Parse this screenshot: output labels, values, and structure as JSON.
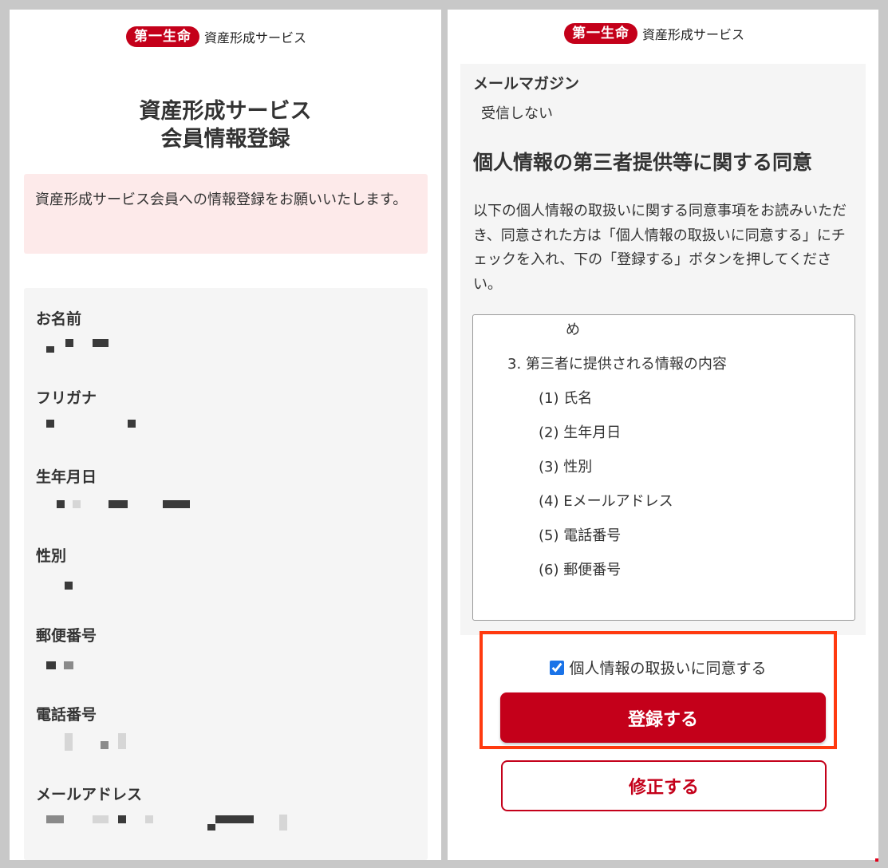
{
  "brand": {
    "logo_text": "第一生命",
    "service_name": "資産形成サービス"
  },
  "left": {
    "title_line1": "資産形成サービス",
    "title_line2": "会員情報登録",
    "notice": "資産形成サービス会員への情報登録をお願いいたします。",
    "fields": {
      "name_label": "お名前",
      "furigana_label": "フリガナ",
      "birthdate_label": "生年月日",
      "gender_label": "性別",
      "postal_label": "郵便番号",
      "phone_label": "電話番号",
      "email_label": "メールアドレス"
    }
  },
  "right": {
    "mail_magazine_label": "メールマガジン",
    "mail_magazine_value": "受信しない",
    "consent_heading": "個人情報の第三者提供等に関する同意",
    "consent_description": "以下の個人情報の取扱いに関する同意事項をお読みいただき、同意された方は「個人情報の取扱いに同意する」にチェックを入れ、下の「登録する」ボタンを押してください。",
    "consent_text": {
      "partial_top": "め",
      "section3": "3. 第三者に提供される情報の内容",
      "items": [
        "(1) 氏名",
        "(2) 生年月日",
        "(3) 性別",
        "(4) Eメールアドレス",
        "(5) 電話番号",
        "(6) 郵便番号"
      ]
    },
    "agree_label": "個人情報の取扱いに同意する",
    "agree_checked": true,
    "register_button": "登録する",
    "edit_button": "修正する"
  },
  "colors": {
    "brand_red": "#c4001a",
    "highlight": "#ff3a0f",
    "notice_bg": "#fdeaea",
    "section_bg": "#f5f5f5"
  }
}
